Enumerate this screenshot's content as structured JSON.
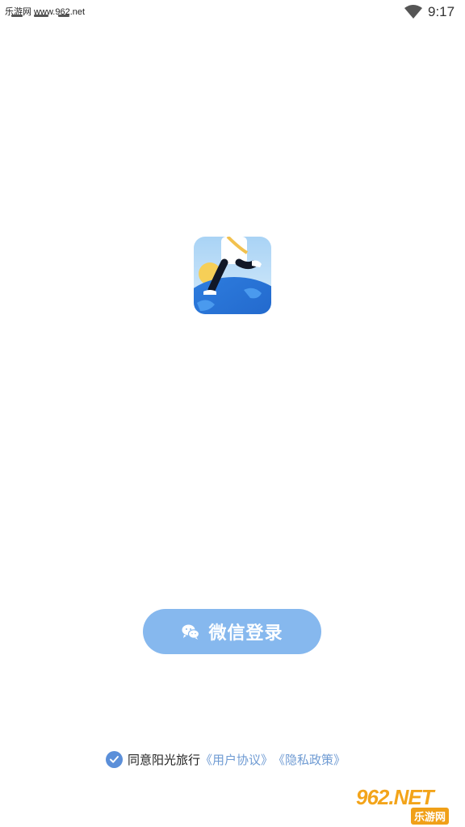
{
  "status_bar": {
    "watermark": "乐游网 www.962.net",
    "time": "9:17"
  },
  "app": {
    "icon": "app-logo-runner"
  },
  "login_button": {
    "label": "微信登录",
    "icon": "wechat-icon",
    "color": "#86b8ee"
  },
  "agreement": {
    "checked": true,
    "prefix": "同意阳光旅行",
    "user_agreement": "《用户协议》",
    "privacy_policy": "《隐私政策》",
    "link_color": "#6f9bd3"
  },
  "watermark_bottom": {
    "main": "962.NET",
    "sub": "乐游网"
  }
}
